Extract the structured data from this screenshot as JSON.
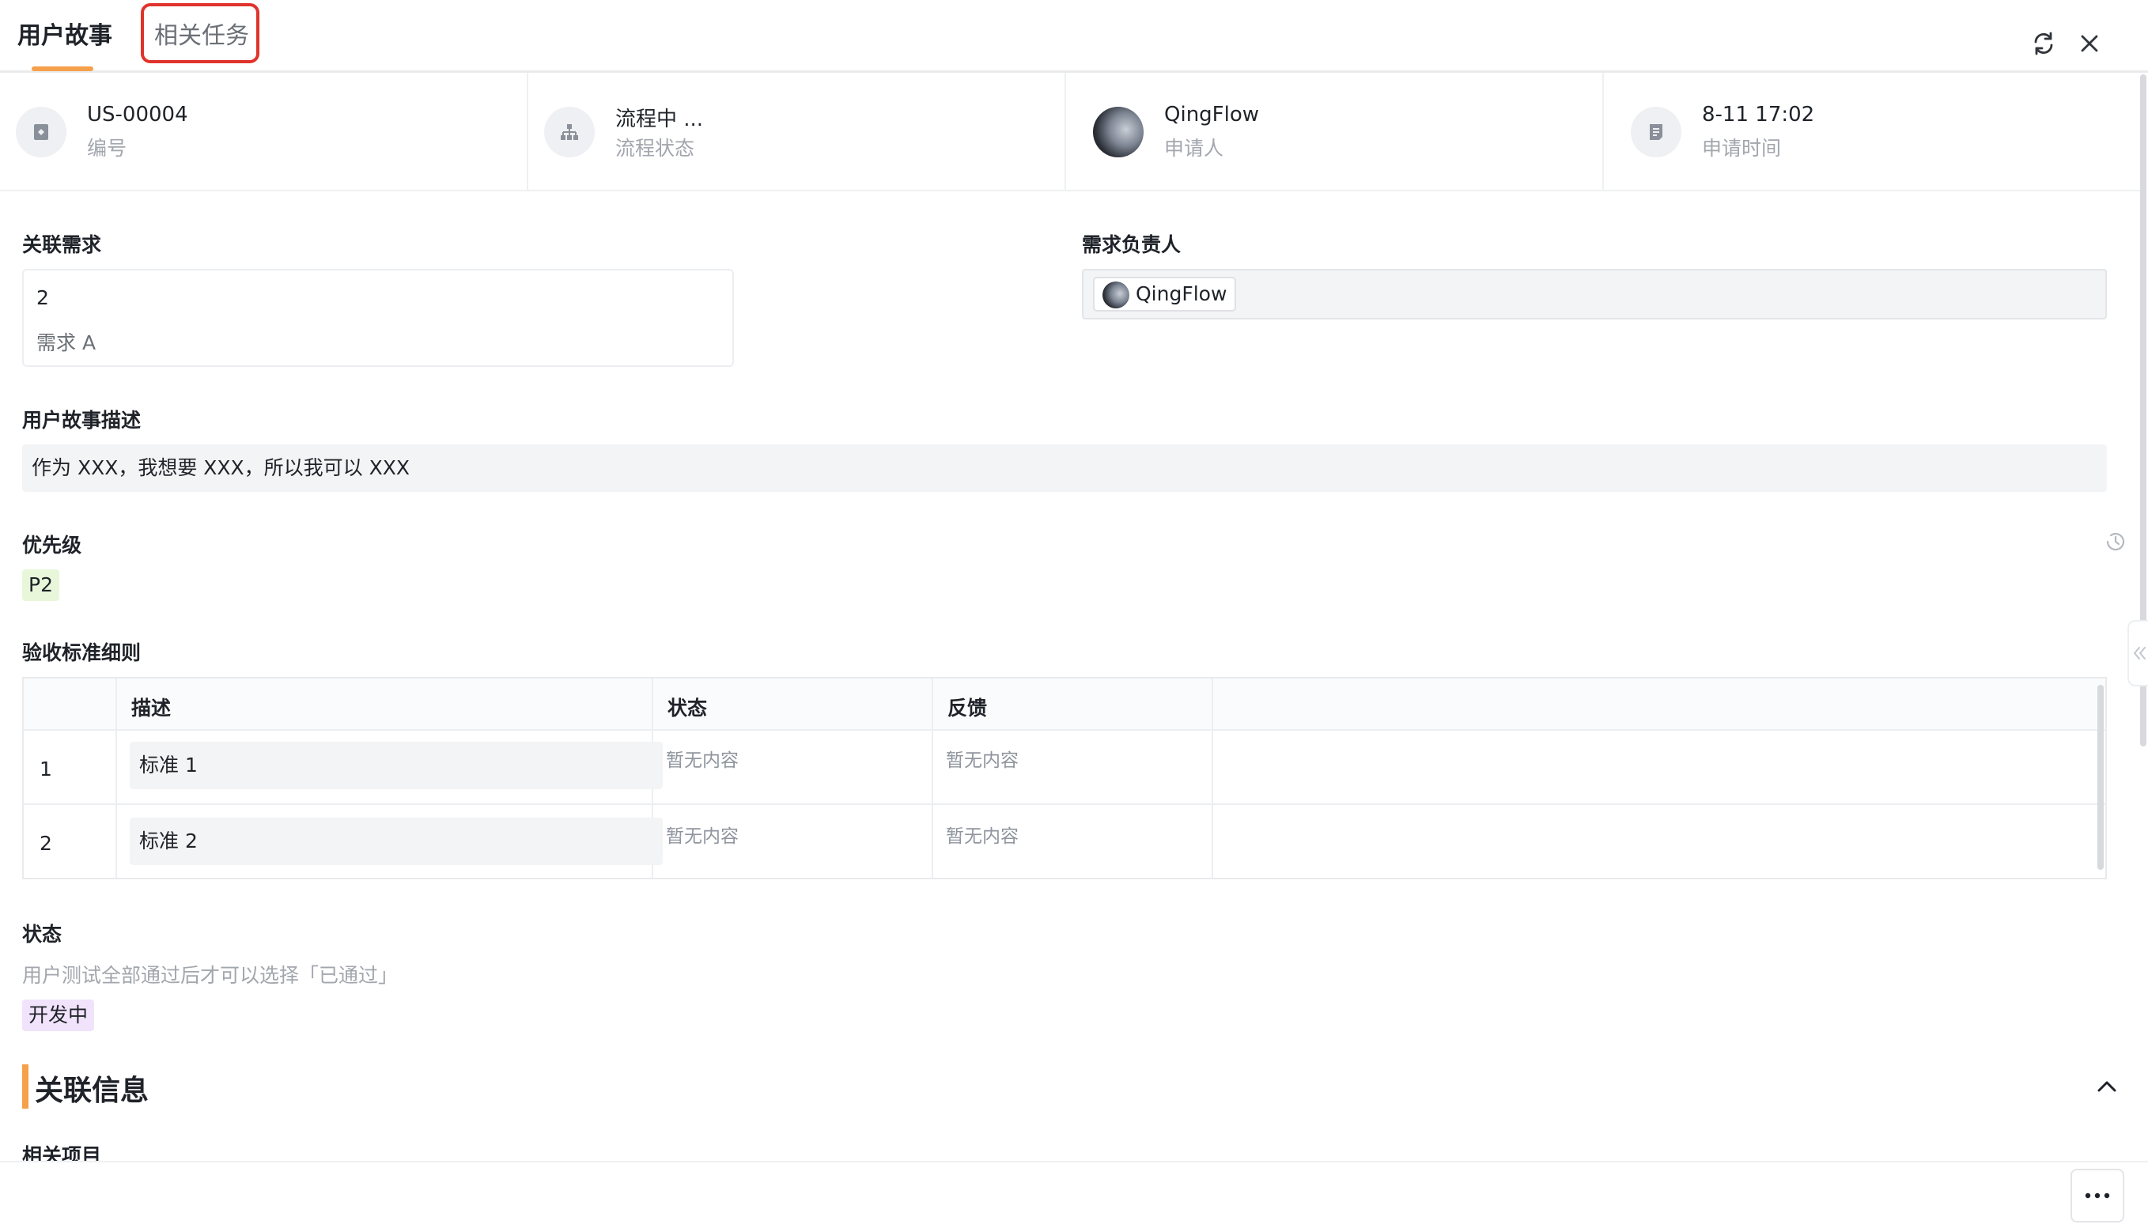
{
  "tabs": {
    "active": "用户故事",
    "other": "相关任务"
  },
  "icons": {
    "refresh": "refresh-icon",
    "close": "close-icon",
    "id": "tag-icon",
    "status": "sitemap-icon",
    "time": "calendar-icon",
    "history": "clock-icon",
    "collapse_side": "double-chevron-left-icon",
    "collapse_section": "chevron-up-icon",
    "more": "ellipsis-icon"
  },
  "summary": {
    "id_value": "US-00004",
    "id_label": "编号",
    "status_value": "流程中 ...",
    "status_label": "流程状态",
    "applicant_value": "QingFlow",
    "applicant_label": "申请人",
    "time_value": "8-11 17:02",
    "time_label": "申请时间"
  },
  "related_need": {
    "label": "关联需求",
    "number": "2",
    "title": "需求 A"
  },
  "need_owner": {
    "label": "需求负责人",
    "name": "QingFlow"
  },
  "story_desc": {
    "label": "用户故事描述",
    "value": "作为 XXX，我想要 XXX，所以我可以 XXX"
  },
  "priority": {
    "label": "优先级",
    "value": "P2",
    "color": "#e8f7d9"
  },
  "criteria": {
    "label": "验收标准细则",
    "headers": [
      "描述",
      "状态",
      "反馈"
    ],
    "rows": [
      {
        "index": "1",
        "desc": "标准 1",
        "status": "暂无内容",
        "feedback": "暂无内容"
      },
      {
        "index": "2",
        "desc": "标准 2",
        "status": "暂无内容",
        "feedback": "暂无内容"
      }
    ]
  },
  "status_field": {
    "label": "状态",
    "hint": "用户测试全部通过后才可以选择「已通过」",
    "value": "开发中",
    "color": "#f1e3fb"
  },
  "related_info": {
    "title": "关联信息",
    "first_field": "相关项目"
  },
  "colors": {
    "accent": "#f5a04a",
    "highlight_border": "#e0332b"
  }
}
